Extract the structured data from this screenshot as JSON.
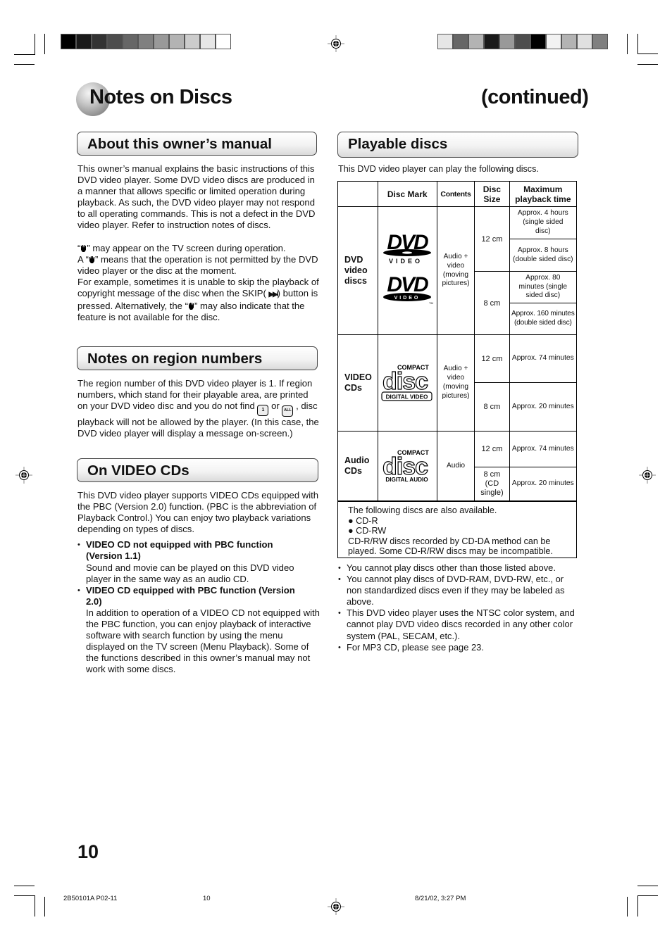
{
  "header": {
    "title": "Notes on Discs",
    "continued": "(continued)",
    "left_colorbar": [
      "#000000",
      "#1a1a1a",
      "#333333",
      "#4d4d4d",
      "#666666",
      "#808080",
      "#999999",
      "#b3b3b3",
      "#cccccc",
      "#e6e6e6",
      "#ffffff"
    ],
    "right_colorbar": [
      "#e6e6e6",
      "#666666",
      "#b3b3b3",
      "#1a1a1a",
      "#999999",
      "#4d4d4d",
      "#000000",
      "#f2f2f2",
      "#b3b3b3",
      "#e0e0e0",
      "#808080"
    ]
  },
  "sections": {
    "about": {
      "heading": "About this owner’s manual",
      "paragraph1": "This owner’s manual explains the basic instructions of this DVD video player. Some DVD video discs are produced in a manner that allows specific or limited operation during playback. As such, the DVD video player may not respond to all operating commands. This is not a defect in the DVD video player. Refer to instruction notes of discs.",
      "p2_a": "“",
      "p2_b": "” may appear on the TV screen during operation.",
      "p2_c": "A “",
      "p2_d": "” means that the operation is not permitted by the DVD video player or the disc at the moment.",
      "p2_e": "For example, sometimes it is unable to skip the playback of copyright message of the disc when the SKIP(",
      "p2_skip_glyph": "▶▶I",
      "p2_f": ") button is pressed. Alternatively, the “",
      "p2_g": "” may also indicate that the feature is not available for the disc."
    },
    "region": {
      "heading": "Notes on region numbers",
      "text_a": "The region number of this DVD video player is 1. If region numbers, which stand for their playable area, are printed on your DVD video disc and you do not find",
      "icon_1": "1",
      "text_b": "or",
      "icon_all": "ALL",
      "text_c": ", disc playback will not be allowed by the player. (In this case, the DVD video player will display a message on-screen.)"
    },
    "video_cd": {
      "heading": "On VIDEO CDs",
      "intro": "This DVD video player supports VIDEO CDs equipped with the PBC (Version 2.0) function. (PBC is the abbreviation of Playback Control.) You can enjoy two playback variations depending on types of discs.",
      "items": [
        {
          "title": "VIDEO CD not equipped with PBC function (Version 1.1)",
          "text": "Sound and movie can be played on this DVD video player in the same way as an audio CD."
        },
        {
          "title": "VIDEO CD equipped with PBC function (Version 2.0)",
          "text": "In addition to operation of a VIDEO CD not equipped with the PBC function, you can enjoy playback of interactive software with search function by using the menu displayed on the TV screen (Menu Playback). Some of the functions described in this owner’s manual may not work with some discs."
        }
      ]
    },
    "playable": {
      "heading": "Playable discs",
      "intro": "This DVD video player can play the following discs.",
      "table": {
        "headers": [
          "",
          "Disc Mark",
          "Contents",
          "Disc Size",
          "Maximum playback time"
        ],
        "rows": [
          {
            "type": "DVD video discs",
            "mark": "DVD VIDEO",
            "contents": "Audio + video (moving pictures)",
            "sizes": [
              {
                "size": "12 cm",
                "times": [
                  "Approx. 4 hours (single sided disc)",
                  "Approx. 8 hours (double sided disc)"
                ]
              },
              {
                "size": "8 cm",
                "times": [
                  "Approx. 80 minutes (single sided disc)",
                  "Approx. 160 minutes (double sided disc)"
                ]
              }
            ]
          },
          {
            "type": "VIDEO CDs",
            "mark": "COMPACT disc DIGITAL VIDEO",
            "contents": "Audio + video (moving pictures)",
            "sizes": [
              {
                "size": "12 cm",
                "times": [
                  "Approx. 74 minutes"
                ]
              },
              {
                "size": "8 cm",
                "times": [
                  "Approx. 20 minutes"
                ]
              }
            ]
          },
          {
            "type": "Audio CDs",
            "mark": "COMPACT disc DIGITAL AUDIO",
            "contents": "Audio",
            "sizes": [
              {
                "size": "12 cm",
                "times": [
                  "Approx. 74 minutes"
                ]
              },
              {
                "size": "8 cm (CD single)",
                "times": [
                  "Approx. 20 minutes"
                ]
              }
            ]
          }
        ]
      },
      "note": {
        "lead": "The following discs are also available.",
        "items": [
          "CD-R",
          "CD-RW"
        ],
        "tail": "CD-R/RW discs recorded by CD-DA method can be played. Some CD-R/RW discs may be incompatible."
      },
      "bullets": [
        "You cannot play discs other than those listed above.",
        "You cannot play discs of DVD-RAM, DVD-RW, etc., or non standardized discs even if they may be labeled as above.",
        "This DVD video player uses the NTSC color system, and cannot play DVD video discs recorded in any other color system (PAL, SECAM, etc.).",
        "For MP3 CD, please see page 23."
      ]
    }
  },
  "footer": {
    "page_number": "10",
    "file_code": "2B50101A P02-11",
    "file_page": "10",
    "timestamp": "8/21/02, 3:27 PM"
  }
}
